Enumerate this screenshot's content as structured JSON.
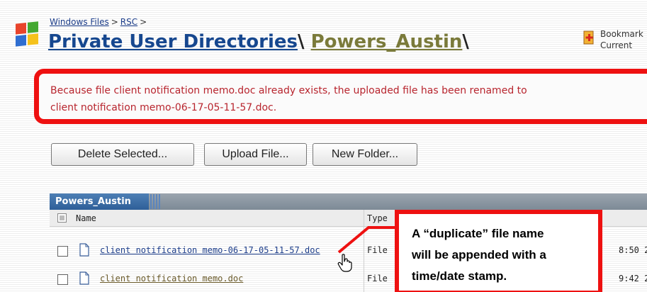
{
  "breadcrumb": {
    "items": [
      "Windows Files",
      "RSC"
    ],
    "separator": ">"
  },
  "title": {
    "part1": "Private User Directories",
    "part2": "Powers_Austin",
    "separator": "\\"
  },
  "bookmark": {
    "line1": "Bookmark",
    "line2": "Current",
    "icon": "bookmark-add-icon"
  },
  "message": {
    "line1": "Because file client notification memo.doc already exists, the uploaded file has been renamed to",
    "line2": "client notification memo-06-17-05-11-57.doc."
  },
  "toolbar": {
    "delete_label": "Delete Selected...",
    "upload_label": "Upload File...",
    "new_folder_label": "New Folder..."
  },
  "table": {
    "tab_label": "Powers_Austin",
    "columns": {
      "name": "Name",
      "type": "Type"
    },
    "rows": [
      {
        "name": "client notification memo-06-17-05-11-57.doc",
        "type": "File",
        "time": "8:50 2"
      },
      {
        "name": "client notification memo.doc",
        "type": "File",
        "time": "9:42 2"
      }
    ]
  },
  "callout": {
    "line1": "A “duplicate” file name",
    "line2": "will be appended with a",
    "line3": "time/date stamp."
  },
  "colors": {
    "highlight_red": "#ee1111",
    "message_text": "#b8252e",
    "link_blue": "#1c3d8a",
    "tab_blue": "#2e5f98"
  }
}
